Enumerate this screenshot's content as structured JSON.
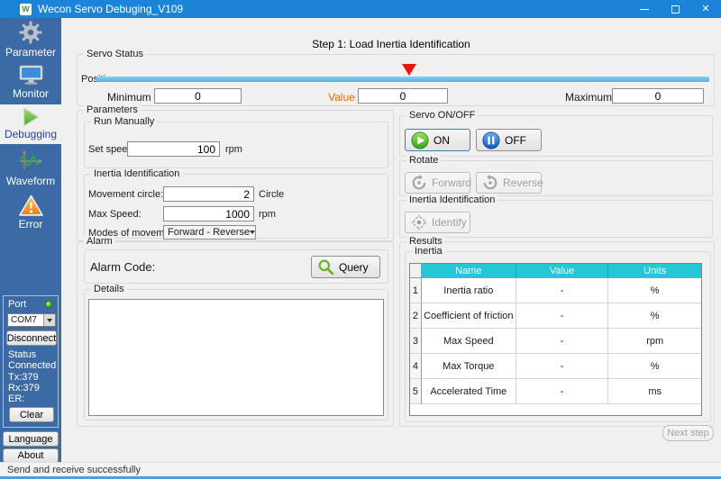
{
  "window": {
    "title": "Wecon Servo Debuging_V109"
  },
  "sidebar": {
    "items": [
      {
        "label": "Parameter"
      },
      {
        "label": "Monitor"
      },
      {
        "label": "Debugging",
        "selected": true
      },
      {
        "label": "Waveform"
      },
      {
        "label": "Error"
      }
    ],
    "port_panel": {
      "port_label": "Port",
      "port_value": "COM7",
      "disconnect_label": "Disconnect",
      "status_label": "Status",
      "status_value": "Connected",
      "tx": "Tx:379",
      "rx": "Rx:379",
      "er": "ER:",
      "clear_label": "Clear"
    },
    "language_label": "Language",
    "about_label": "About"
  },
  "main": {
    "step_title": "Step 1: Load Inertia Identification",
    "servo_status": {
      "group_label": "Servo Status",
      "position_label": "Position:",
      "marker_percent": 51,
      "minimum_label": "Minimum",
      "minimum_value": "0",
      "value_label": "Value",
      "value_value": "0",
      "maximum_label": "Maximum",
      "maximum_value": "0"
    },
    "parameters": {
      "group_label": "Parameters",
      "run_manually": {
        "group_label": "Run Manually",
        "set_speed_label": "Set speed:",
        "set_speed_value": "100",
        "set_speed_unit": "rpm"
      },
      "inertia_identification": {
        "group_label": "Inertia Identification",
        "movement_circle_label": "Movement circle:",
        "movement_circle_value": "2",
        "movement_circle_unit": "Circle",
        "max_speed_label": "Max Speed:",
        "max_speed_value": "1000",
        "max_speed_unit": "rpm",
        "modes_label": "Modes of movement:",
        "modes_value": "Forward - Reverse"
      }
    },
    "servo_onoff": {
      "group_label": "Servo ON/OFF",
      "on_label": "ON",
      "off_label": "OFF"
    },
    "rotate": {
      "group_label": "Rotate",
      "forward_label": "Forward",
      "reverse_label": "Reverse"
    },
    "identify_group": {
      "group_label": "Inertia Identification",
      "identify_label": "Identify"
    },
    "alarm": {
      "group_label": "Alarm",
      "alarm_code_label": "Alarm Code:",
      "query_label": "Query",
      "details_label": "Details",
      "details_value": ""
    },
    "results": {
      "group_label": "Results",
      "inertia_label": "Inertia",
      "table": {
        "columns": [
          "Name",
          "Value",
          "Units"
        ],
        "rows": [
          {
            "num": "1",
            "name": "Inertia ratio",
            "value": "-",
            "units": "%"
          },
          {
            "num": "2",
            "name": "Coefficient of friction",
            "value": "-",
            "units": "%"
          },
          {
            "num": "3",
            "name": "Max Speed",
            "value": "-",
            "units": "rpm"
          },
          {
            "num": "4",
            "name": "Max Torque",
            "value": "-",
            "units": "%"
          },
          {
            "num": "5",
            "name": "Accelerated Time",
            "value": "-",
            "units": "ms"
          }
        ]
      }
    },
    "next_step_label": "Next step"
  },
  "statusbar": {
    "message": "Send and receive successfully"
  },
  "colors": {
    "titlebar_blue": "#1b84d8",
    "sidebar_blue": "#3c6aa5",
    "selected_text_blue": "#2743a6",
    "position_bar_blue": "#5bc0ee",
    "marker_red": "#e8150d",
    "value_label_orange": "#ff6a00",
    "table_header_cyan": "#25c6d8",
    "on_green": "#55aa30",
    "off_blue": "#1f66c0",
    "led_green": "#4fc01c"
  }
}
